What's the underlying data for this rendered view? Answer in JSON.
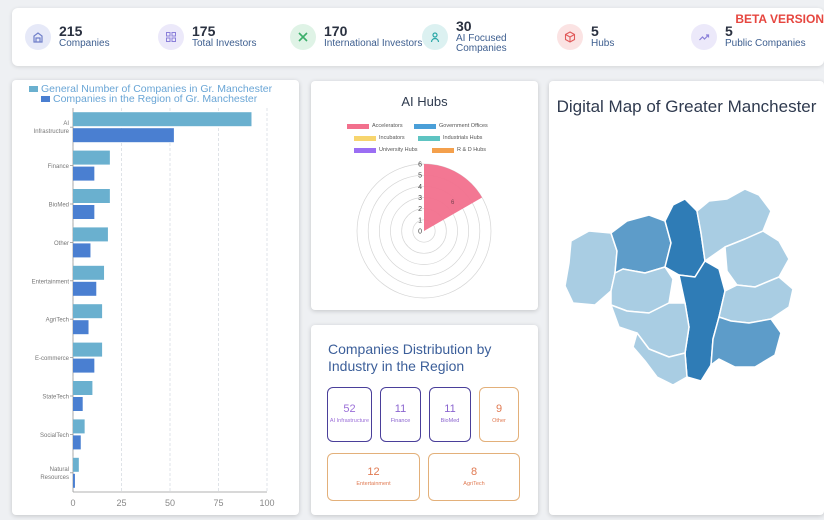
{
  "stats": {
    "companies": {
      "value": "215",
      "label": "Companies",
      "icon": "building-icon",
      "color": "#6f7fc9",
      "bg": "#e6e9f8"
    },
    "total_investors": {
      "value": "175",
      "label": "Total Investors",
      "icon": "grid-icon",
      "color": "#8a7fd9",
      "bg": "#ece9fa"
    },
    "international_investors": {
      "value": "170",
      "label": "International Investors",
      "icon": "cross-arrows-icon",
      "color": "#3cae6a",
      "bg": "#dff3e6"
    },
    "ai_focused": {
      "value": "30",
      "label": "AI Focused Companies",
      "icon": "person-icon",
      "color": "#2aa7a7",
      "bg": "#dcf1f1"
    },
    "hubs": {
      "value": "5",
      "label": "Hubs",
      "icon": "cube-icon",
      "color": "#e05a5a",
      "bg": "#fbe3e3"
    },
    "public_companies": {
      "value": "5",
      "label": "Public Companies",
      "icon": "trend-icon",
      "color": "#8a7fd9",
      "bg": "#ece9fa"
    }
  },
  "beta_label": "BETA VERSION",
  "chart_data": [
    {
      "type": "bar",
      "orientation": "horizontal",
      "categories": [
        "AI Infrastructure",
        "Finance",
        "BioMed",
        "Other",
        "Entertainment",
        "AgriTech",
        "E-commerce",
        "StateTech",
        "SocialTech",
        "Natural Resources"
      ],
      "series": [
        {
          "name": "General Number of Companies in Gr. Manchester",
          "color": "#6ab0cf",
          "values": [
            92,
            19,
            19,
            18,
            16,
            15,
            15,
            10,
            6,
            3
          ]
        },
        {
          "name": "Companies in the Region of Gr. Manchester",
          "color": "#4a7fd1",
          "values": [
            52,
            11,
            11,
            9,
            12,
            8,
            11,
            5,
            4,
            1
          ]
        }
      ],
      "xlim": [
        0,
        100
      ],
      "xticks": [
        "0",
        "25",
        "50",
        "75",
        "100"
      ],
      "grid": true,
      "legend": "top-left"
    },
    {
      "type": "polar-area",
      "title": "AI Hubs",
      "legend": [
        {
          "name": "Accelerators",
          "color": "#f2708d"
        },
        {
          "name": "Government Offices",
          "color": "#4a9fd8"
        },
        {
          "name": "Incubators",
          "color": "#f7d56e"
        },
        {
          "name": "Industrials Hubs",
          "color": "#5ec4c2"
        },
        {
          "name": "University Hubs",
          "color": "#9b6ef3"
        },
        {
          "name": "R & D Hubs",
          "color": "#f4a04c"
        }
      ],
      "values": [
        6,
        0,
        0,
        0,
        0,
        0
      ],
      "value_label": "6",
      "rticks": [
        "0",
        "1",
        "2",
        "3",
        "4",
        "5",
        "6"
      ],
      "rmax": 6
    }
  ],
  "distribution": {
    "title": "Companies Distribution by Industry in the Region",
    "cards": [
      {
        "value": "52",
        "label": "AI Infrastructure",
        "color": "#9b6fd8",
        "border": "#4a3f9a"
      },
      {
        "value": "11",
        "label": "Finance",
        "color": "#8a64cf",
        "border": "#4a3f9a"
      },
      {
        "value": "11",
        "label": "BioMed",
        "color": "#8a64cf",
        "border": "#4a3f9a"
      },
      {
        "value": "9",
        "label": "Other",
        "color": "#e07a52",
        "border": "#e3b07a"
      },
      {
        "value": "12",
        "label": "Entertainment",
        "color": "#e07a52",
        "border": "#e3b07a"
      },
      {
        "value": "8",
        "label": "AgriTech",
        "color": "#e07a52",
        "border": "#e3b07a"
      }
    ]
  },
  "map": {
    "title": "Digital Map of Greater Manchester",
    "colors": {
      "light": "#a9cde3",
      "mid": "#5d9cc9",
      "dark": "#2f7cb6",
      "stroke": "#ffffff"
    }
  }
}
